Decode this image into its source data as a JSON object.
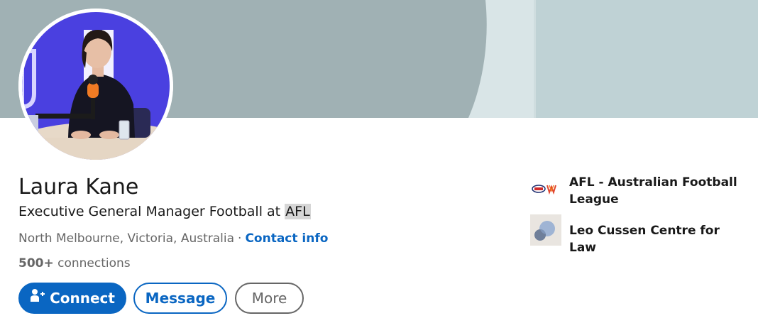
{
  "profile": {
    "name": "Laura Kane",
    "headline_prefix": "Executive General Manager Football at ",
    "headline_highlight": "AFL",
    "location": "North Melbourne, Victoria, Australia",
    "separator": "·",
    "contact_info_label": "Contact info",
    "connections_count": "500+",
    "connections_label": "connections"
  },
  "actions": {
    "connect_label": "Connect",
    "message_label": "Message",
    "more_label": "More"
  },
  "organizations": [
    {
      "name": "AFL - Australian Football League",
      "logo_icon": "afl-logo-icon"
    },
    {
      "name": "Leo Cussen Centre for Law",
      "logo_icon": "leo-cussen-logo-icon"
    }
  ],
  "colors": {
    "primary": "#0a66c2",
    "banner_left": "#9fb0b3",
    "banner_right": "#bfd2d5",
    "avatar_background": "#4b3fe0",
    "text_primary": "#191919",
    "text_secondary": "#666666"
  }
}
